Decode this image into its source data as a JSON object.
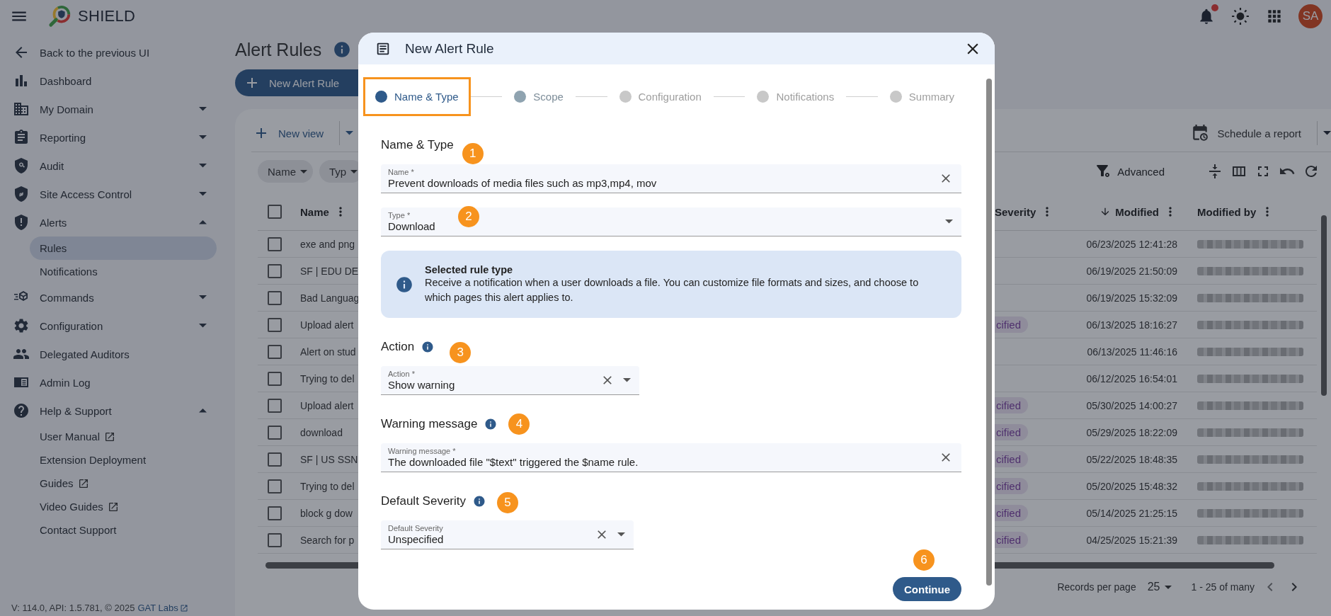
{
  "topbar": {
    "app_name": "SHIELD",
    "avatar": "SA",
    "has_notification": true
  },
  "sidebar": {
    "items": [
      {
        "label": "Back to the previous UI",
        "selected": false
      },
      {
        "label": "Dashboard",
        "selected": false
      },
      {
        "label": "My Domain",
        "selected": false,
        "expanded": false
      },
      {
        "label": "Reporting",
        "selected": false,
        "expanded": false
      },
      {
        "label": "Audit",
        "selected": false,
        "expanded": false
      },
      {
        "label": "Site Access Control",
        "selected": false,
        "expanded": false
      },
      {
        "label": "Alerts",
        "selected": false,
        "expanded": true,
        "children": [
          {
            "label": "Rules",
            "selected": true,
            "external": false
          },
          {
            "label": "Notifications",
            "selected": false,
            "external": false
          }
        ]
      },
      {
        "label": "Commands",
        "selected": false,
        "expanded": false
      },
      {
        "label": "Configuration",
        "selected": false,
        "expanded": false
      },
      {
        "label": "Delegated Auditors",
        "selected": false
      },
      {
        "label": "Admin Log",
        "selected": false
      },
      {
        "label": "Help & Support",
        "selected": false,
        "expanded": true,
        "children": [
          {
            "label": "User Manual",
            "selected": false,
            "external": true
          },
          {
            "label": "Extension Deployment",
            "selected": false,
            "external": false
          },
          {
            "label": "Guides",
            "selected": false,
            "external": true
          },
          {
            "label": "Video Guides",
            "selected": false,
            "external": true
          },
          {
            "label": "Contact Support",
            "selected": false,
            "external": false
          }
        ]
      }
    ],
    "footer": {
      "version": "V: 114.0, API: 1.5.781, © 2025",
      "link": "GAT Labs"
    }
  },
  "page": {
    "title": "Alert Rules",
    "new_button": "New Alert Rule",
    "toolbar": {
      "new_view": "New view",
      "schedule": "Schedule a report",
      "advanced": "Advanced"
    },
    "filter_chips": [
      "Name",
      "Typ"
    ],
    "table": {
      "select_all": false,
      "columns": [
        {
          "label": "Name",
          "sorted": false
        },
        {
          "label": "Severity",
          "sorted": false
        },
        {
          "label": "Modified",
          "sorted": true
        },
        {
          "label": "Modified by",
          "sorted": false
        }
      ],
      "rows": [
        {
          "name": "exe and png",
          "selected": false,
          "modified": "06/23/2025 12:41:28"
        },
        {
          "name": "SF | EDU DE",
          "selected": false,
          "modified": "06/19/2025 21:50:09"
        },
        {
          "name": "Bad Languag",
          "selected": false,
          "modified": "06/19/2025 15:32:09"
        },
        {
          "name": "Upload alert",
          "selected": false,
          "severity": "cified",
          "modified": "06/13/2025 18:16:27"
        },
        {
          "name": "Alert on stud",
          "selected": false,
          "modified": "06/13/2025 11:46:16"
        },
        {
          "name": "Trying to del",
          "selected": false,
          "modified": "06/12/2025 16:54:01"
        },
        {
          "name": "Upload alert",
          "selected": false,
          "severity": "cified",
          "modified": "05/30/2025 14:00:27"
        },
        {
          "name": "download",
          "selected": false,
          "severity": "cified",
          "modified": "05/29/2025 18:22:09"
        },
        {
          "name": "SF | US SSN",
          "selected": false,
          "severity": "cified",
          "modified": "05/22/2025 18:48:35"
        },
        {
          "name": "Trying to del",
          "selected": false,
          "severity": "cified",
          "modified": "05/20/2025 15:48:32"
        },
        {
          "name": "block g dow",
          "selected": false,
          "severity": "cified",
          "modified": "05/14/2025 21:25:15"
        },
        {
          "name": "Search for p",
          "selected": false,
          "severity": "cified",
          "modified": "04/25/2025 15:21:39"
        }
      ]
    },
    "pagination": {
      "label": "Records per page",
      "per_page": "25",
      "range": "1 - 25 of many"
    }
  },
  "modal": {
    "title": "New Alert Rule",
    "steps": [
      {
        "label": "Name & Type",
        "selected": true,
        "disabled": false,
        "highlighted": true
      },
      {
        "label": "Scope",
        "selected": false,
        "disabled": false,
        "highlighted": false
      },
      {
        "label": "Configuration",
        "selected": false,
        "disabled": true,
        "highlighted": false
      },
      {
        "label": "Notifications",
        "selected": false,
        "disabled": true,
        "highlighted": false
      },
      {
        "label": "Summary",
        "selected": false,
        "disabled": true,
        "highlighted": false
      }
    ],
    "sections": [
      {
        "title": "Name & Type",
        "info_icon": false,
        "badge": "1",
        "fields": [
          {
            "label": "Name *",
            "value": "Prevent downloads of media files such as mp3,mp4, mov",
            "clearable": true,
            "dropdown": false
          },
          {
            "label": "Type *",
            "value": "Download",
            "clearable": false,
            "dropdown": true,
            "badge": "2"
          }
        ],
        "note": {
          "title": "Selected rule type",
          "text": "Receive a notification when a user downloads a file. You can customize file formats and sizes, and choose to which pages this alert applies to."
        }
      },
      {
        "title": "Action",
        "info_icon": true,
        "badge": "3",
        "fields": [
          {
            "label": "Action *",
            "value": "Show warning",
            "clearable": true,
            "dropdown": true
          }
        ]
      },
      {
        "title": "Warning message",
        "info_icon": true,
        "badge": "4",
        "fields": [
          {
            "label": "Warning message *",
            "value": "The downloaded file \"$text\" triggered the $name rule.",
            "clearable": true,
            "dropdown": false
          }
        ]
      },
      {
        "title": "Default Severity",
        "info_icon": true,
        "badge": "5",
        "fields": [
          {
            "label": "Default Severity",
            "value": "Unspecified",
            "clearable": true,
            "dropdown": true
          }
        ]
      }
    ],
    "continue": {
      "label": "Continue",
      "badge": "6"
    }
  }
}
